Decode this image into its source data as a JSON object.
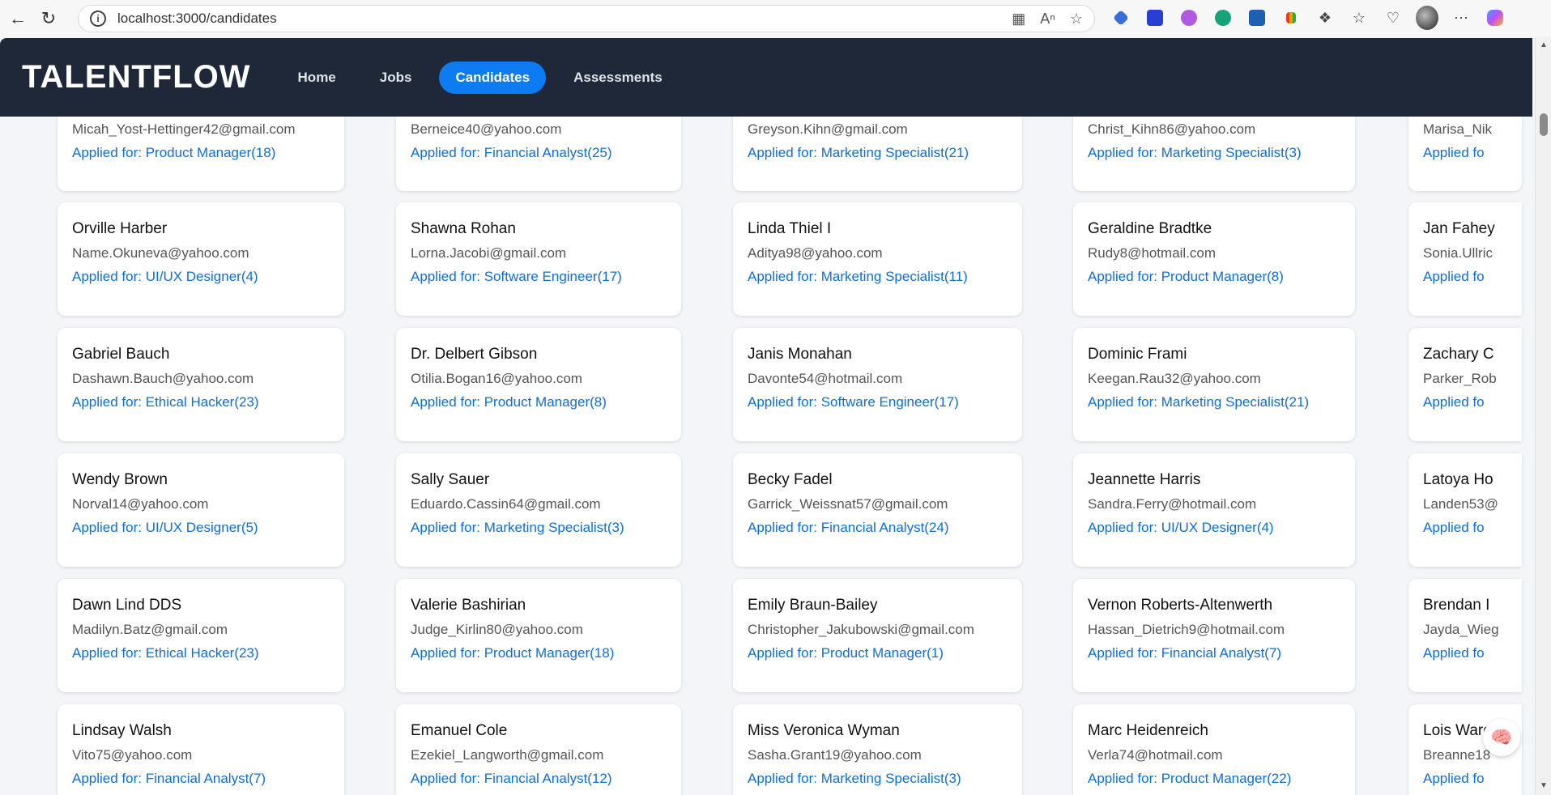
{
  "browser": {
    "url": "localhost:3000/candidates"
  },
  "app": {
    "brand": "TALENTFLOW",
    "nav": [
      {
        "label": "Home",
        "active": false
      },
      {
        "label": "Jobs",
        "active": false
      },
      {
        "label": "Candidates",
        "active": true
      },
      {
        "label": "Assessments",
        "active": false
      }
    ]
  },
  "columns": [
    {
      "top": {
        "email": "Micah_Yost-Hettinger42@gmail.com",
        "applied": "Applied for: Product Manager(18)"
      },
      "cards": [
        {
          "name": "Orville Harber",
          "email": "Name.Okuneva@yahoo.com",
          "applied": "Applied for: UI/UX Designer(4)"
        },
        {
          "name": "Gabriel Bauch",
          "email": "Dashawn.Bauch@yahoo.com",
          "applied": "Applied for: Ethical Hacker(23)"
        },
        {
          "name": "Wendy Brown",
          "email": "Norval14@yahoo.com",
          "applied": "Applied for: UI/UX Designer(5)"
        },
        {
          "name": "Dawn Lind DDS",
          "email": "Madilyn.Batz@gmail.com",
          "applied": "Applied for: Ethical Hacker(23)"
        },
        {
          "name": "Lindsay Walsh",
          "email": "Vito75@yahoo.com",
          "applied": "Applied for: Financial Analyst(7)"
        }
      ]
    },
    {
      "top": {
        "email": "Berneice40@yahoo.com",
        "applied": "Applied for: Financial Analyst(25)"
      },
      "cards": [
        {
          "name": "Shawna Rohan",
          "email": "Lorna.Jacobi@gmail.com",
          "applied": "Applied for: Software Engineer(17)"
        },
        {
          "name": "Dr. Delbert Gibson",
          "email": "Otilia.Bogan16@yahoo.com",
          "applied": "Applied for: Product Manager(8)"
        },
        {
          "name": "Sally Sauer",
          "email": "Eduardo.Cassin64@gmail.com",
          "applied": "Applied for: Marketing Specialist(3)"
        },
        {
          "name": "Valerie Bashirian",
          "email": "Judge_Kirlin80@yahoo.com",
          "applied": "Applied for: Product Manager(18)"
        },
        {
          "name": "Emanuel Cole",
          "email": "Ezekiel_Langworth@gmail.com",
          "applied": "Applied for: Financial Analyst(12)"
        }
      ]
    },
    {
      "top": {
        "email": "Greyson.Kihn@gmail.com",
        "applied": "Applied for: Marketing Specialist(21)"
      },
      "cards": [
        {
          "name": "Linda Thiel I",
          "email": "Aditya98@yahoo.com",
          "applied": "Applied for: Marketing Specialist(11)"
        },
        {
          "name": "Janis Monahan",
          "email": "Davonte54@hotmail.com",
          "applied": "Applied for: Software Engineer(17)"
        },
        {
          "name": "Becky Fadel",
          "email": "Garrick_Weissnat57@gmail.com",
          "applied": "Applied for: Financial Analyst(24)"
        },
        {
          "name": "Emily Braun-Bailey",
          "email": "Christopher_Jakubowski@gmail.com",
          "applied": "Applied for: Product Manager(1)"
        },
        {
          "name": "Miss Veronica Wyman",
          "email": "Sasha.Grant19@yahoo.com",
          "applied": "Applied for: Marketing Specialist(3)"
        }
      ]
    },
    {
      "top": {
        "email": "Christ_Kihn86@yahoo.com",
        "applied": "Applied for: Marketing Specialist(3)"
      },
      "cards": [
        {
          "name": "Geraldine Bradtke",
          "email": "Rudy8@hotmail.com",
          "applied": "Applied for: Product Manager(8)"
        },
        {
          "name": "Dominic Frami",
          "email": "Keegan.Rau32@yahoo.com",
          "applied": "Applied for: Marketing Specialist(21)"
        },
        {
          "name": "Jeannette Harris",
          "email": "Sandra.Ferry@hotmail.com",
          "applied": "Applied for: UI/UX Designer(4)"
        },
        {
          "name": "Vernon Roberts-Altenwerth",
          "email": "Hassan_Dietrich9@hotmail.com",
          "applied": "Applied for: Financial Analyst(7)"
        },
        {
          "name": "Marc Heidenreich",
          "email": "Verla74@hotmail.com",
          "applied": "Applied for: Product Manager(22)"
        }
      ]
    },
    {
      "top": {
        "email": "Marisa_Nik",
        "applied": "Applied fo"
      },
      "cards": [
        {
          "name": "Jan Fahey",
          "email": "Sonia.Ullric",
          "applied": "Applied fo"
        },
        {
          "name": "Zachary C",
          "email": "Parker_Rob",
          "applied": "Applied fo"
        },
        {
          "name": "Latoya Ho",
          "email": "Landen53@",
          "applied": "Applied fo"
        },
        {
          "name": "Brendan I",
          "email": "Jayda_Wieg",
          "applied": "Applied fo"
        },
        {
          "name": "Lois Ward",
          "email": "Breanne18",
          "applied": "Applied fo"
        }
      ]
    }
  ]
}
